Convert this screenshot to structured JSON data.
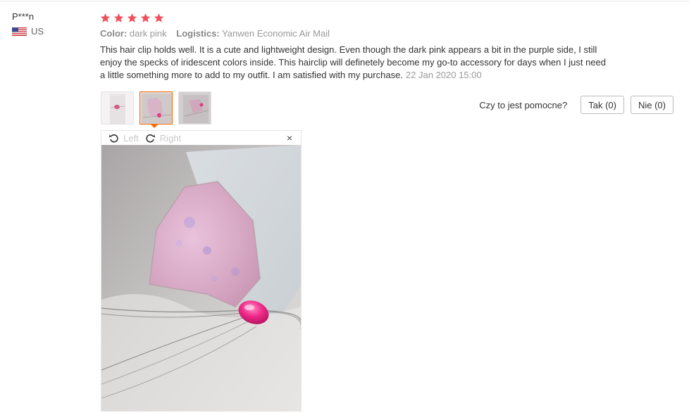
{
  "user": {
    "name": "P***n",
    "country": "US",
    "flag_icon": "us-flag-icon"
  },
  "review": {
    "rating": 5,
    "rating_max": 5,
    "star_color": "#f0505a",
    "color_label": "Color:",
    "color_value": "dark pink",
    "logistics_label": "Logistics:",
    "logistics_value": "Yanwen Economic Air Mail",
    "text": "This hair clip holds well. It is a cute and lightweight design. Even though the dark pink appears a bit in the purple side, I still enjoy the specks of iridescent colors inside. This hairclip will definetely become my go-to accessory for days when I just need a little something more to add to my outfit. I am satisfied with my purchase.",
    "date": "22 Jan 2020 15:00"
  },
  "thumbnails": [
    {
      "name": "photo-thumbnail-1",
      "active": false
    },
    {
      "name": "photo-thumbnail-2",
      "active": true
    },
    {
      "name": "photo-thumbnail-3",
      "active": false
    }
  ],
  "helpful": {
    "question": "Czy to jest pomocne?",
    "yes_label": "Tak (0)",
    "no_label": "Nie (0)"
  },
  "viewer": {
    "rotate_left_label": "Left",
    "rotate_right_label": "Right",
    "close_label": "×",
    "accent_color": "#ff6a00"
  }
}
